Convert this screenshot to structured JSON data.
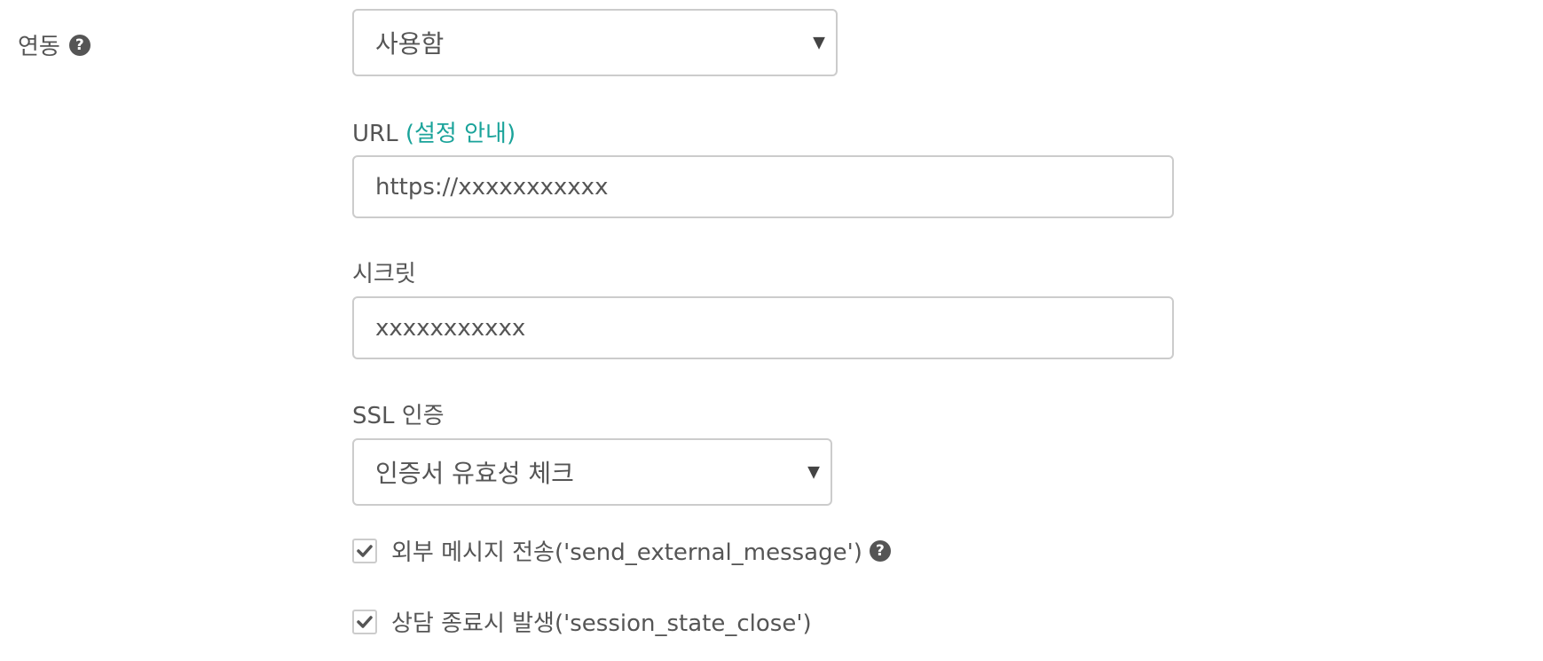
{
  "integration": {
    "label": "연동",
    "help_icon": "question-circle-icon",
    "select_value": "사용함",
    "caret": "▼"
  },
  "url": {
    "label": "URL",
    "guide_link": "(설정 안내)",
    "value": "https://xxxxxxxxxxx"
  },
  "secret": {
    "label": "시크릿",
    "value": "xxxxxxxxxxx"
  },
  "ssl": {
    "label": "SSL 인증",
    "select_value": "인증서 유효성 체크",
    "caret": "▼"
  },
  "checkboxes": [
    {
      "label": "외부 메시지 전송('send_external_message')",
      "checked": true,
      "help_icon": "question-circle-icon"
    },
    {
      "label": "상담 종료시 발생('session_state_close')",
      "checked": true
    }
  ],
  "colors": {
    "text": "#555555",
    "link": "#1aa39a",
    "border": "#cccccc"
  }
}
